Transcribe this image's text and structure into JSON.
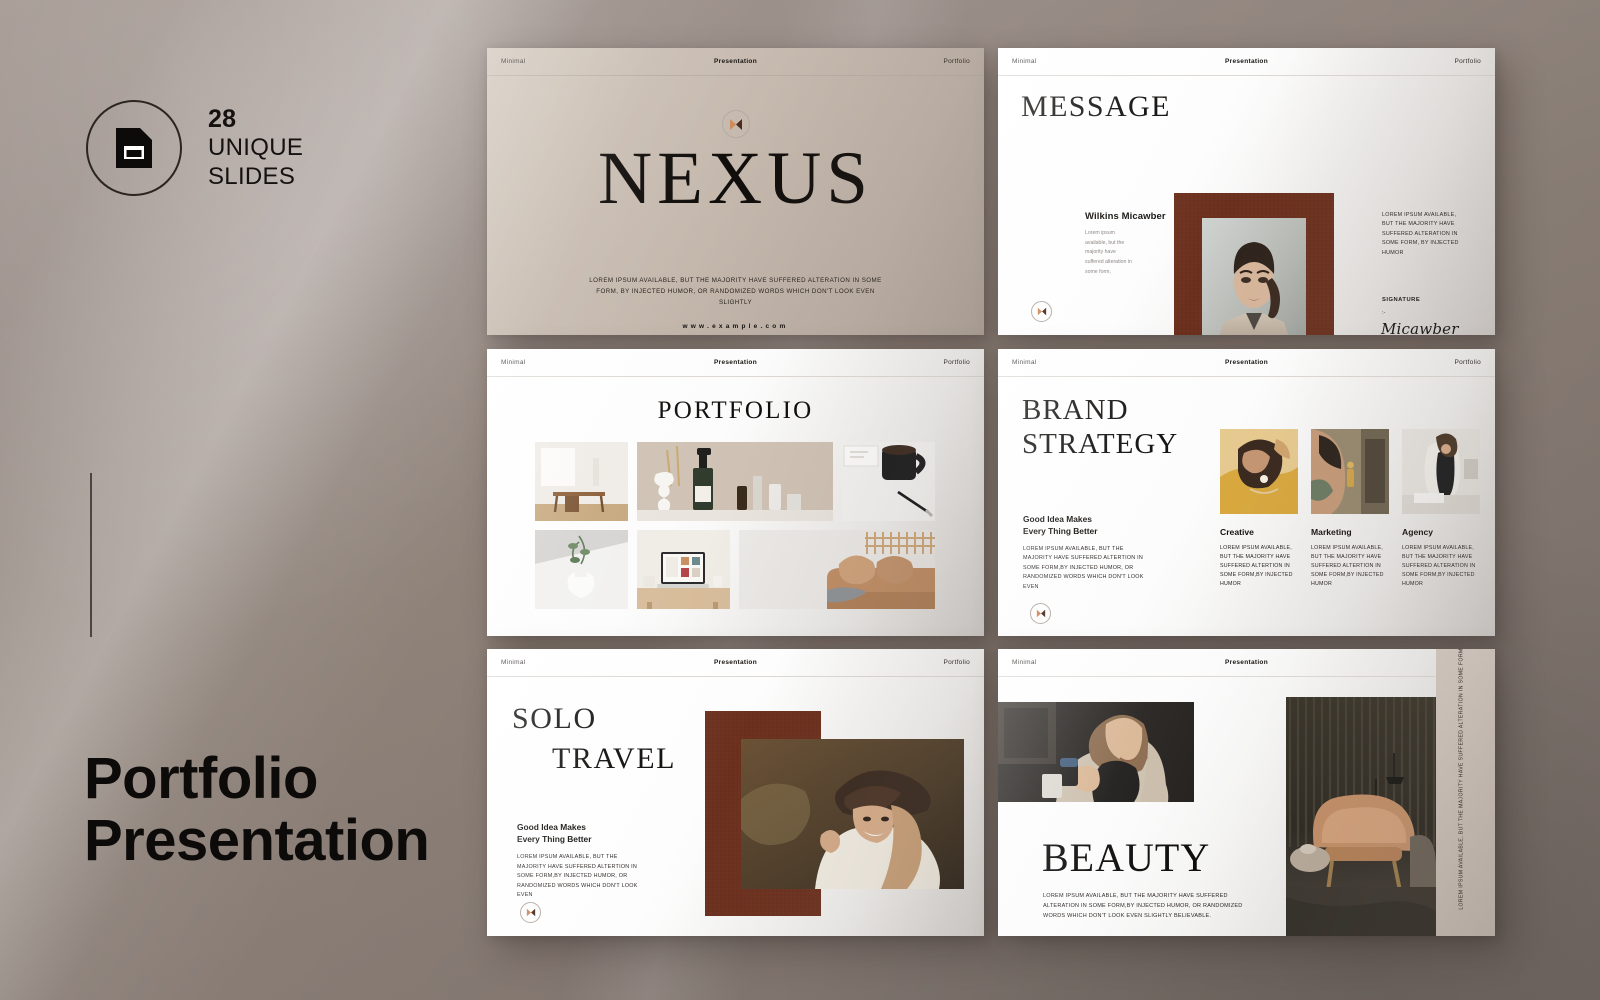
{
  "left_panel": {
    "badge": {
      "icon": "slides-document-icon",
      "count": "28",
      "line1": "UNIQUE",
      "line2": "SLIDES"
    },
    "hero_line1": "Portfolio",
    "hero_line2": "Presentation"
  },
  "slide_header": {
    "left": "Minimal",
    "center": "Presentation",
    "right": "Portfolio",
    "logo_icon": "play-mark-logo-icon"
  },
  "slides": [
    {
      "id": "nexus",
      "title": "NEXUS",
      "subtitle": "LOREM IPSUM AVAILABLE, BUT THE MAJORITY HAVE SUFFERED ALTERATION  IN SOME FORM, BY INJECTED HUMOR, OR RANDOMIZED  WORDS WHICH DON'T LOOK EVEN SLIGHTLY",
      "url": "www.example.com"
    },
    {
      "id": "message",
      "title": "MESSAGE",
      "person_name": "Wilkins Micawber",
      "person_body": "Lorem ipsum available, but the majority have suffered alteration in some form,",
      "right_body": "LOREM IPSUM AVAILABLE, BUT THE MAJORITY HAVE SUFFERED ALTERATION IN SOME FORM, BY INJECTED HUMOR",
      "signature_label": "SIGNATURE",
      "signature_colon": ":-",
      "signature_name": "Micawber",
      "photo_alt": "portrait-of-woman-in-beige-blazer"
    },
    {
      "id": "portfolio",
      "title": "PORTFOLIO",
      "tiles": [
        "dining-table-in-bright-room",
        "skincare-bottles-and-white-vase",
        "black-mug-and-pen-on-desk",
        "white-ribbed-vase-with-eucalyptus",
        "laptop-on-wooden-desk",
        "tan-sofa-with-cushions"
      ]
    },
    {
      "id": "brand-strategy",
      "title_line1": "BRAND",
      "title_line2": "STRATEGY",
      "subhead_line1": "Good Idea Makes",
      "subhead_line2": "Every Thing Better",
      "body": "LOREM IPSUM AVAILABLE, BUT THE MAJORITY HAVE SUFFERED ALTERTION  IN SOME FORM,BY INJECTED HUMOR, OR RANDOMIZED  WORDS WHICH DON'T LOOK EVEN",
      "cards": [
        {
          "title": "Creative",
          "text": "LOREM IPSUM AVAILABLE, BUT THE MAJORITY HAVE SUFFERED ALTERTION IN SOME FORM,BY INJECTED HUMOR",
          "photo_alt": "woman-with-gold-earrings-yellow-top"
        },
        {
          "title": "Marketing",
          "text": "LOREM IPSUM AVAILABLE, BUT THE MAJORITY HAVE SUFFERED ALTERTION  IN SOME FORM,BY INJECTED HUMOR",
          "photo_alt": "close-up-of-statement-earring"
        },
        {
          "title": "Agency",
          "text": "LOREM IPSUM AVAILABLE, BUT THE MAJORITY HAVE SUFFERED ALTERATION IN SOME FORM,BY INJECTED HUMOR",
          "photo_alt": "woman-working-at-white-desk"
        }
      ]
    },
    {
      "id": "solo-travel",
      "title_line1": "SOLO",
      "title_line2": "TRAVEL",
      "subhead_line1": "Good Idea Makes",
      "subhead_line2": "Every Thing Better",
      "body": "LOREM IPSUM AVAILABLE,  BUT THE MAJORITY HAVE SUFFERED ALTERTION IN SOME FORM,BY INJECTED HUMOR, OR RANDOMIZED  WORDS WHICH DON'T LOOK EVEN",
      "photo_alt": "smiling-woman-with-wide-brim-hat"
    },
    {
      "id": "beauty",
      "title": "BEAUTY",
      "body": "LOREM IPSUM AVAILABLE, BUT THE MAJORITY  HAVE SUFFERED ALTERATION IN SOME FORM,BY INJECTED HUMOR, OR RANDOMIZED  WORDS WHICH DON'T LOOK EVEN SLIGHTLY  BELIEVABLE.",
      "vertical_text": "LOREM IPSUM AVAILABLE, BUT THE MAJORITY HAVE SUFFERED ALTERATION IN SOME FORM BY INJECTED",
      "photo_alt_top": "woman-with-coffee-cup-on-street",
      "photo_alt_right": "dim-lounge-with-tan-sofa"
    }
  ],
  "colors": {
    "backdrop": "#8d827d",
    "slide_one_bg": "#c7bbb0",
    "accent_brown": "#6b2f1d",
    "logo_orange": "#d08a5a",
    "logo_dark": "#4a2a1d",
    "ink": "#0f0d0b"
  }
}
